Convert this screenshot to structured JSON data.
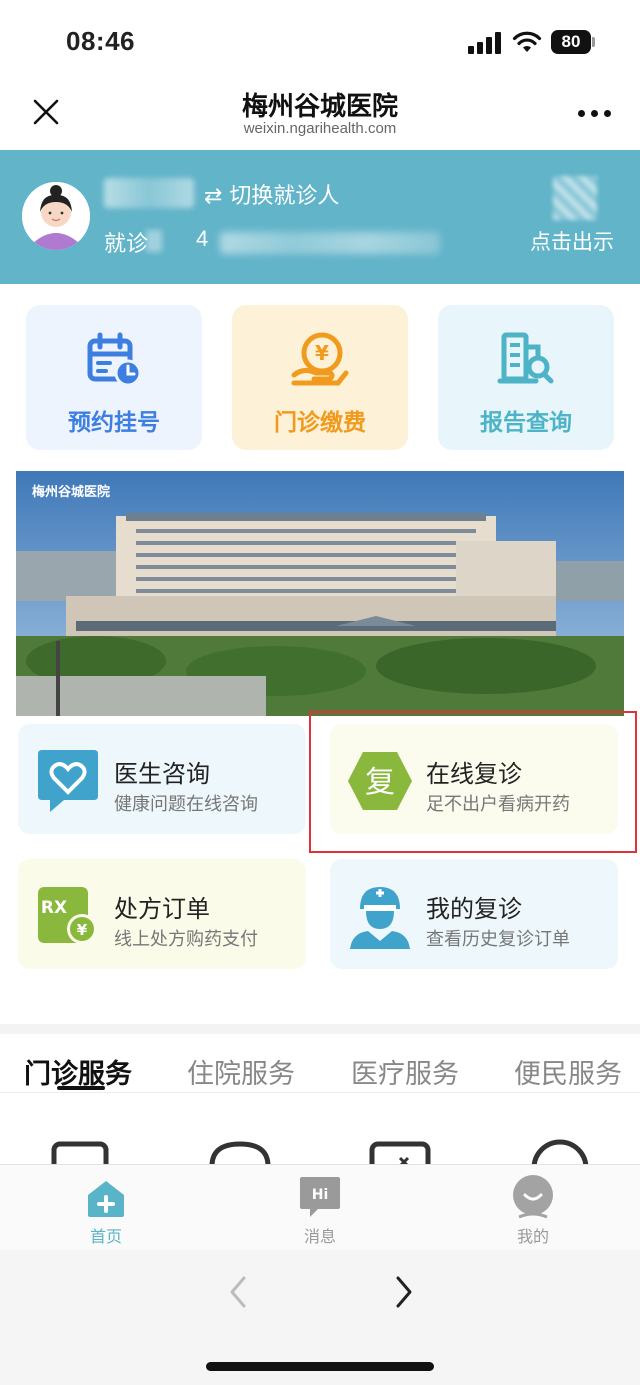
{
  "status_bar": {
    "time": "08:46",
    "battery": "80"
  },
  "navbar": {
    "title": "梅州谷城医院",
    "subtitle": "weixin.ngarihealth.com"
  },
  "patient": {
    "switch_label": "⇄ 切换就诊人",
    "visit_label": "就诊",
    "visit_number": "4",
    "qr_label": "点击出示"
  },
  "quick_tiles": [
    {
      "label": "预约挂号",
      "icon": "calendar-clock-icon",
      "color": "#3d7fe0"
    },
    {
      "label": "门诊缴费",
      "icon": "coin-hand-icon",
      "color": "#f09a1e"
    },
    {
      "label": "报告查询",
      "icon": "report-search-icon",
      "color": "#4db3c6"
    }
  ],
  "banner": {
    "logo_text": "梅州谷城医院"
  },
  "services": [
    {
      "title": "医生咨询",
      "subtitle": "健康问题在线咨询",
      "icon": "heart-chat-icon"
    },
    {
      "title": "在线复诊",
      "subtitle": "足不出户看病开药",
      "icon": "revisit-hexagon-icon",
      "icon_text": "复"
    },
    {
      "title": "处方订单",
      "subtitle": "线上处方购药支付",
      "icon": "rx-prescription-icon",
      "icon_text": "RX"
    },
    {
      "title": "我的复诊",
      "subtitle": "查看历史复诊订单",
      "icon": "nurse-icon"
    }
  ],
  "tabs": [
    "门诊服务",
    "住院服务",
    "医疗服务",
    "便民服务"
  ],
  "active_tab": "门诊服务",
  "bottom_nav": [
    {
      "label": "首页",
      "icon": "home-plus-icon",
      "active": true
    },
    {
      "label": "消息",
      "icon": "message-hi-icon",
      "icon_text": "Hi",
      "active": false
    },
    {
      "label": "我的",
      "icon": "profile-icon",
      "active": false
    }
  ],
  "colors": {
    "primary": "#62b4c9",
    "highlight": "#e0323a"
  }
}
